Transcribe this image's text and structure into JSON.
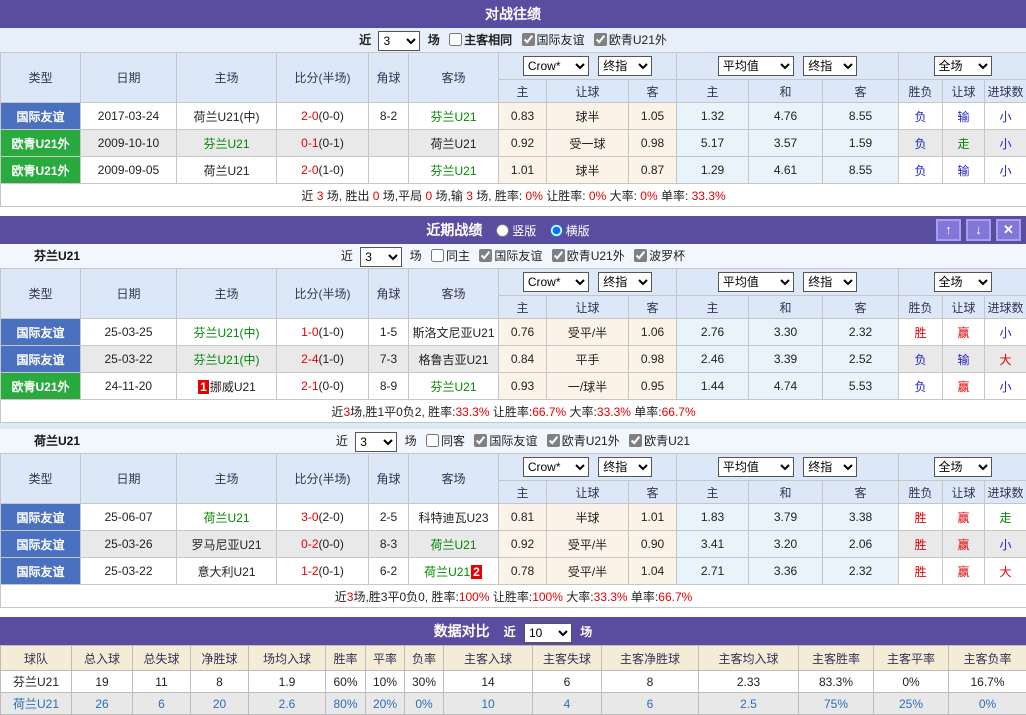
{
  "colors": {
    "red": "#e60000",
    "blue": "#2222cc",
    "green": "#008800",
    "teamGreen": "#008800",
    "typeBlue": "#4a70c0",
    "typeGreen": "#29a93e",
    "rowBlue": "#2a6ebb",
    "purple": "#5a4da0"
  },
  "common": {
    "near": "近",
    "games": "场",
    "cols": [
      "类型",
      "日期",
      "主场",
      "比分(半场)",
      "角球",
      "客场"
    ],
    "subcols": [
      "主",
      "让球",
      "客",
      "主",
      "和",
      "客",
      "胜负",
      "让球",
      "进球数"
    ],
    "dd": {
      "source": "Crow*",
      "final1": "终指",
      "avg": "平均值",
      "final2": "终指",
      "scope": "全场"
    }
  },
  "h2h": {
    "title": "对战往绩",
    "n": "3",
    "same": "主客相同",
    "checks": [
      "国际友谊",
      "欧青U21外"
    ],
    "rows": [
      {
        "type": {
          "t": "国际友谊",
          "bg": "typeBlue"
        },
        "date": "2017-03-24",
        "home": {
          "t": "荷兰U21(中)"
        },
        "score": {
          "s": "2-0",
          "h": "(0-0)"
        },
        "corner": "8-2",
        "away": {
          "t": "芬兰U21",
          "c": "teamGreen"
        },
        "o1": "0.83",
        "o2": "球半",
        "o3": "1.05",
        "a1": "1.32",
        "a2": "4.76",
        "a3": "8.55",
        "r1": {
          "t": "负",
          "c": "blue"
        },
        "r2": {
          "t": "输",
          "c": "blue"
        },
        "r3": {
          "t": "小",
          "c": "blue"
        }
      },
      {
        "type": {
          "t": "欧青U21外",
          "bg": "typeGreen"
        },
        "date": "2009-10-10",
        "home": {
          "t": "芬兰U21",
          "c": "teamGreen"
        },
        "score": {
          "s": "0-1",
          "h": "(0-1)"
        },
        "corner": "",
        "away": {
          "t": "荷兰U21"
        },
        "o1": "0.92",
        "o2": "受一球",
        "o3": "0.98",
        "a1": "5.17",
        "a2": "3.57",
        "a3": "1.59",
        "r1": {
          "t": "负",
          "c": "blue"
        },
        "r2": {
          "t": "走",
          "c": "green"
        },
        "r3": {
          "t": "小",
          "c": "blue"
        }
      },
      {
        "type": {
          "t": "欧青U21外",
          "bg": "typeGreen"
        },
        "date": "2009-09-05",
        "home": {
          "t": "荷兰U21"
        },
        "score": {
          "s": "2-0",
          "h": "(1-0)"
        },
        "corner": "",
        "away": {
          "t": "芬兰U21",
          "c": "teamGreen"
        },
        "o1": "1.01",
        "o2": "球半",
        "o3": "0.87",
        "a1": "1.29",
        "a2": "4.61",
        "a3": "8.55",
        "r1": {
          "t": "负",
          "c": "blue"
        },
        "r2": {
          "t": "输",
          "c": "blue"
        },
        "r3": {
          "t": "小",
          "c": "blue"
        }
      }
    ],
    "summary": [
      {
        "t": "近 "
      },
      {
        "t": "3",
        "c": "red"
      },
      {
        "t": " 场, 胜出 "
      },
      {
        "t": "0",
        "c": "red"
      },
      {
        "t": " 场,平局 "
      },
      {
        "t": "0",
        "c": "red"
      },
      {
        "t": " 场,输 "
      },
      {
        "t": "3",
        "c": "red"
      },
      {
        "t": " 场, 胜率: "
      },
      {
        "t": "0%",
        "c": "red"
      },
      {
        "t": " 让胜率: "
      },
      {
        "t": "0%",
        "c": "red"
      },
      {
        "t": " 大率: "
      },
      {
        "t": "0%",
        "c": "red"
      },
      {
        "t": " 单率: "
      },
      {
        "t": "33.3%",
        "c": "red"
      }
    ]
  },
  "recent": {
    "title": "近期战绩",
    "radio_vertical": "竖版",
    "radio_horizontal": "横版",
    "finland": {
      "team": "芬兰U21",
      "n": "3",
      "same": "同主",
      "checks": [
        "国际友谊",
        "欧青U21外",
        "波罗杯"
      ],
      "rows": [
        {
          "type": {
            "t": "国际友谊",
            "bg": "typeBlue"
          },
          "date": "25-03-25",
          "home": {
            "t": "芬兰U21(中)",
            "c": "teamGreen"
          },
          "score": {
            "s": "1-0",
            "h": "(1-0)"
          },
          "corner": "1-5",
          "away": {
            "t": "斯洛文尼亚U21"
          },
          "o1": "0.76",
          "o2": "受平/半",
          "o3": "1.06",
          "a1": "2.76",
          "a2": "3.30",
          "a3": "2.32",
          "r1": {
            "t": "胜",
            "c": "red"
          },
          "r2": {
            "t": "赢",
            "c": "red"
          },
          "r3": {
            "t": "小",
            "c": "blue"
          }
        },
        {
          "type": {
            "t": "国际友谊",
            "bg": "typeBlue"
          },
          "date": "25-03-22",
          "home": {
            "t": "芬兰U21(中)",
            "c": "teamGreen"
          },
          "score": {
            "s": "2-4",
            "h": "(1-0)"
          },
          "corner": "7-3",
          "away": {
            "t": "格鲁吉亚U21"
          },
          "o1": "0.84",
          "o2": "平手",
          "o3": "0.98",
          "a1": "2.46",
          "a2": "3.39",
          "a3": "2.52",
          "r1": {
            "t": "负",
            "c": "blue"
          },
          "r2": {
            "t": "输",
            "c": "blue"
          },
          "r3": {
            "t": "大",
            "c": "red"
          }
        },
        {
          "type": {
            "t": "欧青U21外",
            "bg": "typeGreen"
          },
          "date": "24-11-20",
          "home": {
            "pre": "1",
            "t": "挪威U21"
          },
          "score": {
            "s": "2-1",
            "h": "(0-0)"
          },
          "corner": "8-9",
          "away": {
            "t": "芬兰U21",
            "c": "teamGreen"
          },
          "o1": "0.93",
          "o2": "一/球半",
          "o3": "0.95",
          "a1": "1.44",
          "a2": "4.74",
          "a3": "5.53",
          "r1": {
            "t": "负",
            "c": "blue"
          },
          "r2": {
            "t": "赢",
            "c": "red"
          },
          "r3": {
            "t": "小",
            "c": "blue"
          }
        }
      ],
      "summary": [
        {
          "t": "近"
        },
        {
          "t": "3",
          "c": "red"
        },
        {
          "t": "场,胜1平0负2, 胜率:"
        },
        {
          "t": "33.3%",
          "c": "red"
        },
        {
          "t": " 让胜率:"
        },
        {
          "t": "66.7%",
          "c": "red"
        },
        {
          "t": " 大率:"
        },
        {
          "t": "33.3%",
          "c": "red"
        },
        {
          "t": " 单率:"
        },
        {
          "t": "66.7%",
          "c": "red"
        }
      ]
    },
    "netherlands": {
      "team": "荷兰U21",
      "n": "3",
      "same": "同客",
      "checks": [
        "国际友谊",
        "欧青U21外",
        "欧青U21"
      ],
      "rows": [
        {
          "type": {
            "t": "国际友谊",
            "bg": "typeBlue"
          },
          "date": "25-06-07",
          "home": {
            "t": "荷兰U21",
            "c": "teamGreen"
          },
          "score": {
            "s": "3-0",
            "h": "(2-0)"
          },
          "corner": "2-5",
          "away": {
            "t": "科特迪瓦U23"
          },
          "o1": "0.81",
          "o2": "半球",
          "o3": "1.01",
          "a1": "1.83",
          "a2": "3.79",
          "a3": "3.38",
          "r1": {
            "t": "胜",
            "c": "red"
          },
          "r2": {
            "t": "赢",
            "c": "red"
          },
          "r3": {
            "t": "走",
            "c": "green"
          }
        },
        {
          "type": {
            "t": "国际友谊",
            "bg": "typeBlue"
          },
          "date": "25-03-26",
          "home": {
            "t": "罗马尼亚U21"
          },
          "score": {
            "s": "0-2",
            "h": "(0-0)"
          },
          "corner": "8-3",
          "away": {
            "t": "荷兰U21",
            "c": "teamGreen"
          },
          "o1": "0.92",
          "o2": "受平/半",
          "o3": "0.90",
          "a1": "3.41",
          "a2": "3.20",
          "a3": "2.06",
          "r1": {
            "t": "胜",
            "c": "red"
          },
          "r2": {
            "t": "赢",
            "c": "red"
          },
          "r3": {
            "t": "小",
            "c": "blue"
          }
        },
        {
          "type": {
            "t": "国际友谊",
            "bg": "typeBlue"
          },
          "date": "25-03-22",
          "home": {
            "t": "意大利U21"
          },
          "score": {
            "s": "1-2",
            "h": "(0-1)"
          },
          "corner": "6-2",
          "away": {
            "t": "荷兰U21",
            "c": "teamGreen",
            "post": "2"
          },
          "o1": "0.78",
          "o2": "受平/半",
          "o3": "1.04",
          "a1": "2.71",
          "a2": "3.36",
          "a3": "2.32",
          "r1": {
            "t": "胜",
            "c": "red"
          },
          "r2": {
            "t": "赢",
            "c": "red"
          },
          "r3": {
            "t": "大",
            "c": "red"
          }
        }
      ],
      "summary": [
        {
          "t": "近"
        },
        {
          "t": "3",
          "c": "red"
        },
        {
          "t": "场,胜3平0负0, 胜率:"
        },
        {
          "t": "100%",
          "c": "red"
        },
        {
          "t": " 让胜率:"
        },
        {
          "t": "100%",
          "c": "red"
        },
        {
          "t": " 大率:"
        },
        {
          "t": "33.3%",
          "c": "red"
        },
        {
          "t": " 单率:"
        },
        {
          "t": "66.7%",
          "c": "red"
        }
      ]
    }
  },
  "compare": {
    "title": "数据对比",
    "n": "10",
    "headers": [
      "球队",
      "总入球",
      "总失球",
      "净胜球",
      "场均入球",
      "胜率",
      "平率",
      "负率",
      "主客入球",
      "主客失球",
      "主客净胜球",
      "主客均入球",
      "主客胜率",
      "主客平率",
      "主客负率"
    ],
    "rows": [
      {
        "cells": [
          "芬兰U21",
          "19",
          "11",
          "8",
          "1.9",
          "60%",
          "10%",
          "30%",
          "14",
          "6",
          "8",
          "2.33",
          "83.3%",
          "0%",
          "16.7%"
        ]
      },
      {
        "cells": [
          "荷兰U21",
          "26",
          "6",
          "20",
          "2.6",
          "80%",
          "20%",
          "0%",
          "10",
          "4",
          "6",
          "2.5",
          "75%",
          "25%",
          "0%"
        ],
        "c": "rowBlue"
      }
    ]
  }
}
